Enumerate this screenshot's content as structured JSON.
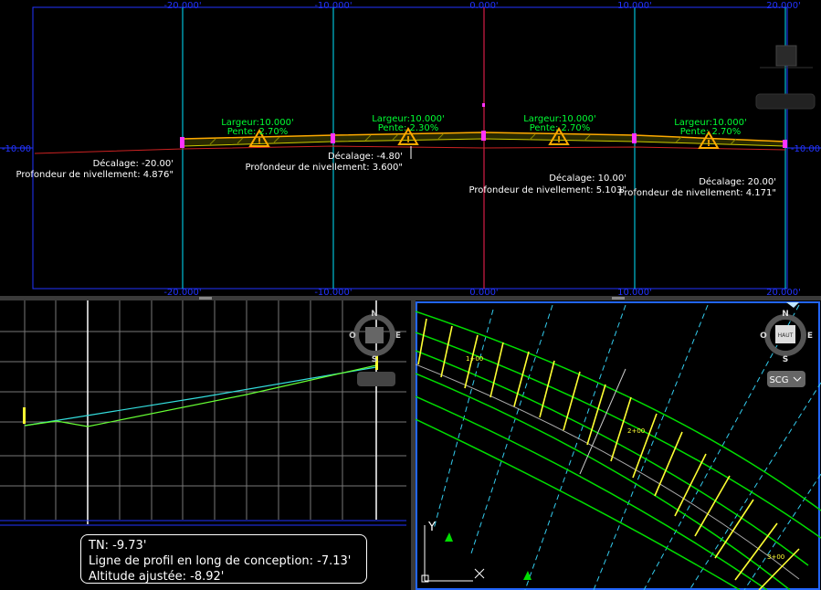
{
  "section_view": {
    "top_axis_labels": [
      "-20.000'",
      "-10.000'",
      "0.000'",
      "10.000'",
      "20.000'"
    ],
    "bottom_axis_labels": [
      "-20.000'",
      "-10.000'",
      "0.000'",
      "10.000'",
      "20.000'"
    ],
    "left_elev_label": "-10.00",
    "right_elev_label": "-10.00",
    "lanes": [
      {
        "width": "Largeur:10.000'",
        "slope": "Pente: 2.70%"
      },
      {
        "width": "Largeur:10.000'",
        "slope": "Pente: 2.30%"
      },
      {
        "width": "Largeur:10.000'",
        "slope": "Pente: 2.70%"
      },
      {
        "width": "Largeur:10.000'",
        "slope": "Pente: 2.70%"
      }
    ],
    "offsets": [
      {
        "offset": "Décalage: -20.00'",
        "depth": "Profondeur de nivellement: 4.876\""
      },
      {
        "offset": "Décalage: -4.80'",
        "depth": "Profondeur de nivellement: 3.600\""
      },
      {
        "offset": "Décalage: 10.00'",
        "depth": "Profondeur de nivellement: 5.103\""
      },
      {
        "offset": "Décalage: 20.00'",
        "depth": "Profondeur de nivellement: 4.171\""
      }
    ]
  },
  "profile_view": {
    "compass": {
      "n": "N",
      "s": "S",
      "e": "E",
      "w": "O"
    }
  },
  "plan_view": {
    "compass": {
      "n": "N",
      "s": "S",
      "e": "E",
      "w": "O",
      "cube": "HAUT"
    },
    "wcs_label": "SCG",
    "ucs_y": "Y",
    "station_labels": [
      "1+00",
      "2+00",
      "3+00"
    ]
  },
  "tooltip": {
    "line1": "TN:  -9.73'",
    "line2": "Ligne de profil en long de conception:  -7.13'",
    "line3": "Altitude ajustée:  -8.92'"
  },
  "colors": {
    "background": "#000000",
    "grid_cyan": "#00e5ff",
    "frame_blue": "#2233ff",
    "label_green": "#00ff33",
    "label_white": "#ffffff",
    "marker_orange": "#ffaa00",
    "centerline_red": "#ff2255",
    "corridor_green": "#00ff00",
    "station_yellow": "#ffff33"
  }
}
